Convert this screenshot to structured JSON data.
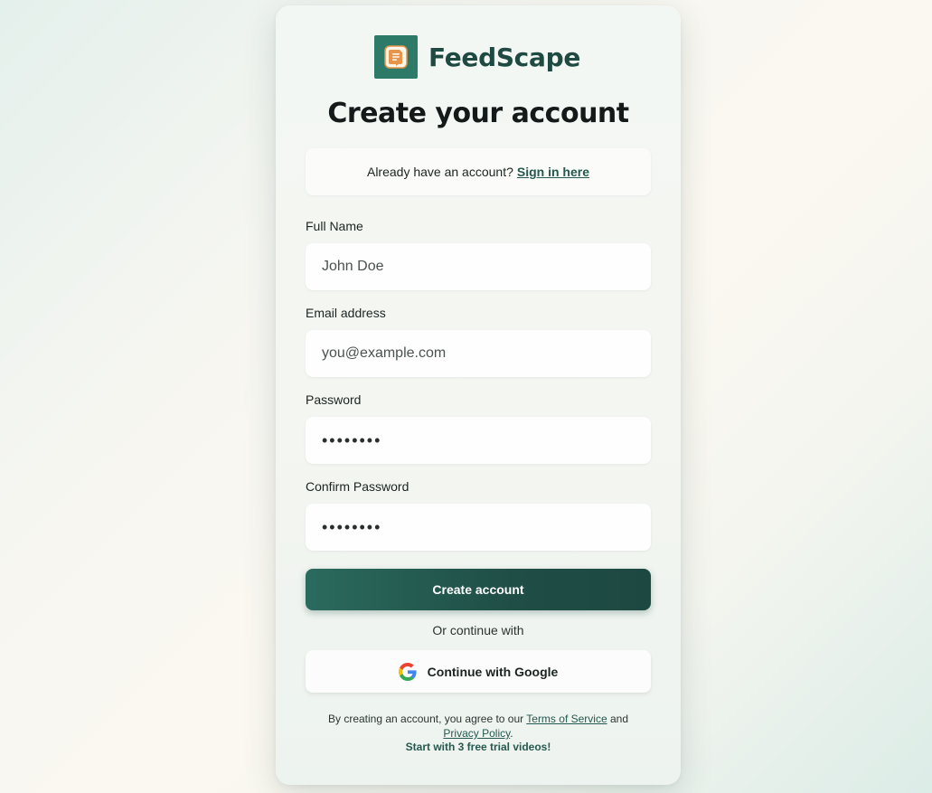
{
  "brand": {
    "name": "FeedScape",
    "logo_icon": "document-icon",
    "logo_color": "#2d7a68",
    "accent_color": "#e8944a"
  },
  "heading": "Create your account",
  "signin": {
    "prompt": "Already have an account?",
    "link_label": "Sign in here"
  },
  "form": {
    "full_name": {
      "label": "Full Name",
      "placeholder": "John Doe",
      "value": ""
    },
    "email": {
      "label": "Email address",
      "placeholder": "you@example.com",
      "value": ""
    },
    "password": {
      "label": "Password",
      "value": "secret12"
    },
    "confirm_password": {
      "label": "Confirm Password",
      "value": "secret12"
    },
    "submit_label": "Create account"
  },
  "divider_text": "Or continue with",
  "google": {
    "label": "Continue with Google",
    "icon": "google-icon"
  },
  "legal": {
    "prefix": "By creating an account, you agree to our",
    "terms_label": "Terms of Service",
    "and": "and",
    "privacy_label": "Privacy Policy",
    "suffix": "."
  },
  "trial_note": "Start with 3 free trial videos!",
  "colors": {
    "primary": "#1f4e46",
    "link": "#25594f"
  }
}
